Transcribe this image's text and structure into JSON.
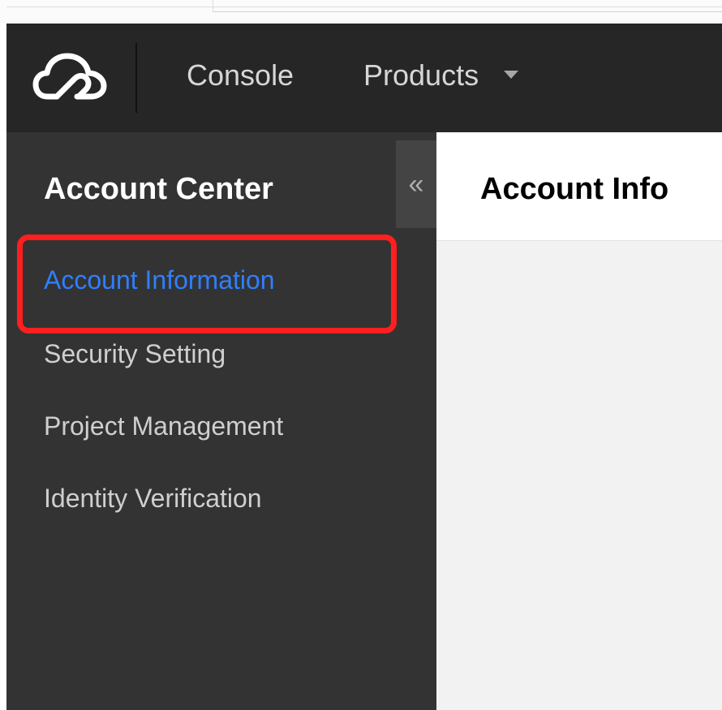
{
  "topnav": {
    "logo_icon": "cloud-logo-icon",
    "console_label": "Console",
    "products_label": "Products",
    "products_caret_icon": "caret-down-icon"
  },
  "sidebar": {
    "title": "Account Center",
    "collapse_icon": "double-chevron-left-icon",
    "collapse_glyph": "«",
    "items": [
      {
        "label": "Account Information",
        "active": true
      },
      {
        "label": "Security Setting",
        "active": false
      },
      {
        "label": "Project Management",
        "active": false
      },
      {
        "label": "Identity Verification",
        "active": false
      }
    ]
  },
  "content": {
    "title": "Account Info"
  },
  "colors": {
    "nav_bg": "#262626",
    "sidebar_bg": "#333333",
    "active_link": "#2f7fff",
    "highlight_border": "#ff1f1f",
    "content_bg": "#f2f2f2"
  }
}
